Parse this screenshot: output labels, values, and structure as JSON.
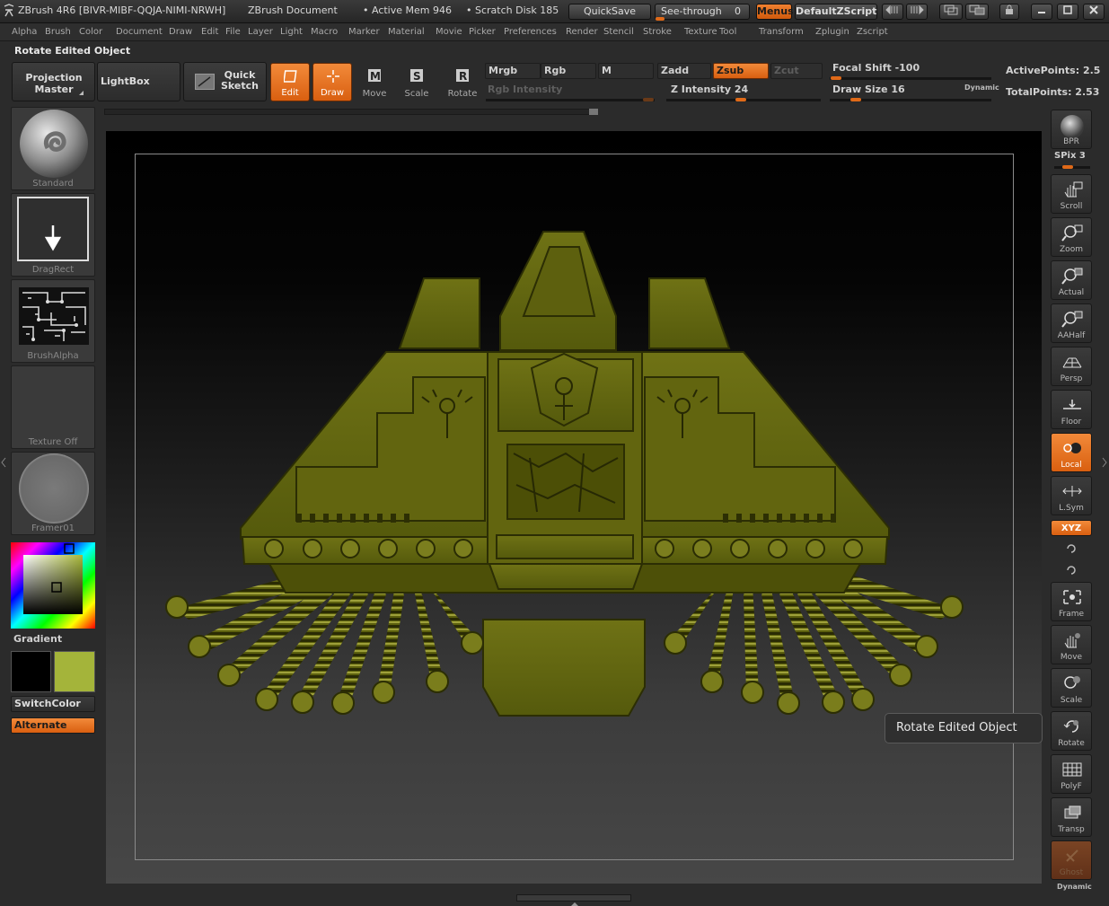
{
  "titlebar": {
    "app_title": "ZBrush 4R6 [BIVR-MIBF-QQJA-NIMI-NRWH]",
    "document": "ZBrush Document",
    "active_mem": "• Active Mem 946",
    "scratch_disk": "• Scratch Disk 185",
    "quicksave": "QuickSave",
    "see_through": "See-through",
    "see_through_value": "0",
    "menus": "Menus",
    "default_zscript": "DefaultZScript"
  },
  "menu": [
    "Alpha",
    "Brush",
    "Color",
    "Document",
    "Draw",
    "Edit",
    "File",
    "Layer",
    "Light",
    "Macro",
    "Marker",
    "Material",
    "Movie",
    "Picker",
    "Preferences",
    "Render",
    "Stencil",
    "Stroke",
    "Texture",
    "Tool",
    "Transform",
    "Zplugin",
    "Zscript"
  ],
  "palette_title": "Rotate Edited Object",
  "shelf": {
    "projection_master": "Projection Master",
    "lightbox": "LightBox",
    "quick_sketch": "Quick Sketch",
    "tools": [
      {
        "label": "Edit",
        "on": true
      },
      {
        "label": "Draw",
        "on": true
      },
      {
        "label": "Move",
        "on": false
      },
      {
        "label": "Scale",
        "on": false
      },
      {
        "label": "Rotate",
        "on": false
      }
    ],
    "mrgb": "Mrgb",
    "rgb": "Rgb",
    "m": "M",
    "zadd": "Zadd",
    "zsub": "Zsub",
    "zcut": "Zcut",
    "rgb_intensity": "Rgb Intensity",
    "z_intensity": "Z Intensity 24",
    "focal_shift": "Focal Shift -100",
    "draw_size": "Draw Size 16",
    "dynamic": "Dynamic",
    "active_points": "ActivePoints: 2.5",
    "total_points": "TotalPoints: 2.53"
  },
  "left_tray": {
    "brush": "Standard",
    "stroke": "DragRect",
    "alpha": "BrushAlpha",
    "texture": "Texture Off",
    "material": "Framer01",
    "gradient": "Gradient",
    "switch_color": "SwitchColor",
    "alternate": "Alternate",
    "colors": {
      "main": "#000000",
      "secondary": "#a4b43a"
    }
  },
  "right_tray": {
    "bpr": "BPR",
    "spix": "SPix 3",
    "scroll": "Scroll",
    "zoom": "Zoom",
    "actual": "Actual",
    "aahalf": "AAHalf",
    "persp": "Persp",
    "floor": "Floor",
    "local": "Local",
    "lsym": "L.Sym",
    "xyz": "XYZ",
    "frame": "Frame",
    "move": "Move",
    "scale": "Scale",
    "rotate": "Rotate",
    "polyf": "PolyF",
    "transp": "Transp",
    "ghost": "Ghost",
    "dynamic": "Dynamic"
  },
  "tooltip": "Rotate Edited Object",
  "accent_color": "#e8721e",
  "model_color": "#6b6d12"
}
